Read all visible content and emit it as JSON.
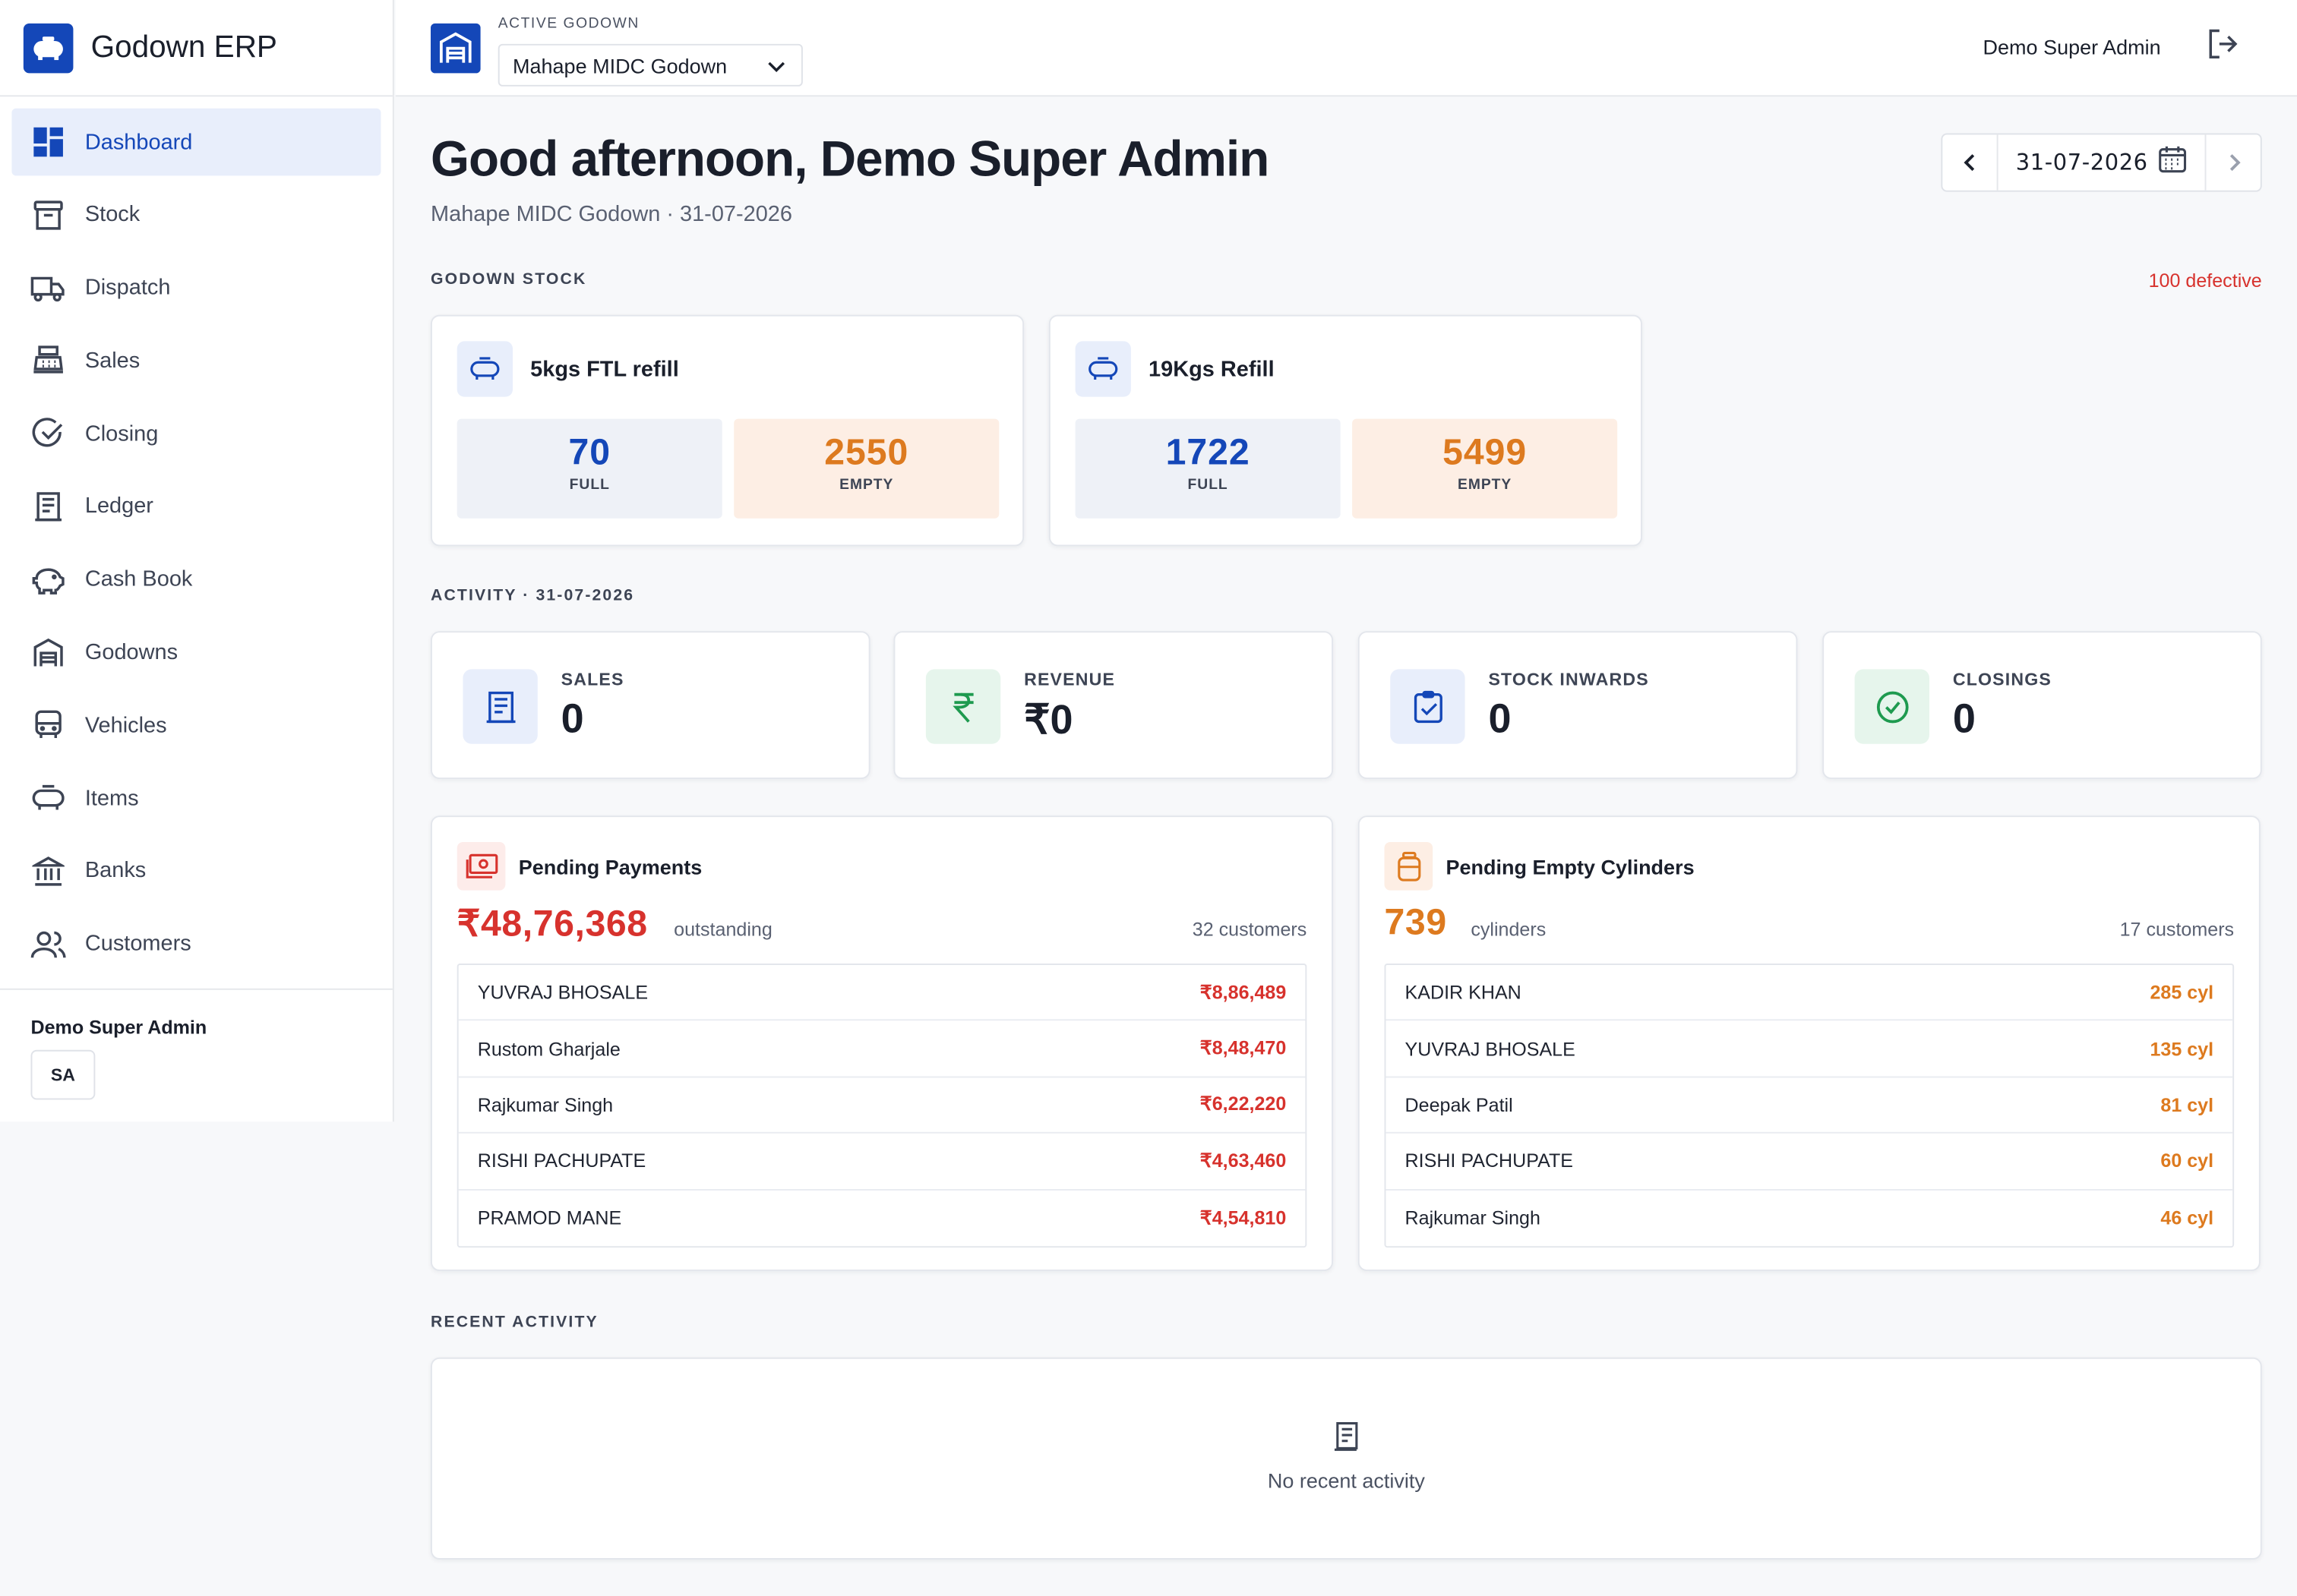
{
  "brand": {
    "name": "Godown ERP"
  },
  "sidebar": {
    "items": [
      {
        "label": "Dashboard",
        "icon": "dashboard-icon",
        "active": true
      },
      {
        "label": "Stock",
        "icon": "archive-icon"
      },
      {
        "label": "Dispatch",
        "icon": "truck-icon"
      },
      {
        "label": "Sales",
        "icon": "cash-register-icon"
      },
      {
        "label": "Closing",
        "icon": "check-circle-icon"
      },
      {
        "label": "Ledger",
        "icon": "receipt-icon"
      },
      {
        "label": "Cash Book",
        "icon": "piggy-bank-icon"
      },
      {
        "label": "Godowns",
        "icon": "warehouse-icon"
      },
      {
        "label": "Vehicles",
        "icon": "bus-icon"
      },
      {
        "label": "Items",
        "icon": "cylinder-icon"
      },
      {
        "label": "Banks",
        "icon": "bank-icon"
      },
      {
        "label": "Customers",
        "icon": "users-icon"
      }
    ],
    "user_name": "Demo Super Admin",
    "user_initials": "SA"
  },
  "header": {
    "active_label": "ACTIVE GODOWN",
    "godown": "Mahape MIDC Godown",
    "user": "Demo Super Admin"
  },
  "main": {
    "greeting": "Good afternoon, Demo Super Admin",
    "subline": "Mahape MIDC Godown · 31-07-2026",
    "date": "31-07-2026",
    "stock_title": "GODOWN STOCK",
    "defective": "100 defective",
    "stock": [
      {
        "name": "5kgs FTL refill",
        "full": "70",
        "full_label": "FULL",
        "empty": "2550",
        "empty_label": "EMPTY"
      },
      {
        "name": "19Kgs Refill",
        "full": "1722",
        "full_label": "FULL",
        "empty": "5499",
        "empty_label": "EMPTY"
      }
    ],
    "activity_title": "ACTIVITY · 31-07-2026",
    "activity": [
      {
        "label": "SALES",
        "value": "0"
      },
      {
        "label": "REVENUE",
        "value": "₹0"
      },
      {
        "label": "STOCK INWARDS",
        "value": "0"
      },
      {
        "label": "CLOSINGS",
        "value": "0"
      }
    ],
    "payments": {
      "title": "Pending Payments",
      "total": "₹48,76,368",
      "unit": "outstanding",
      "count": "32 customers",
      "rows": [
        {
          "name": "YUVRAJ BHOSALE",
          "value": "₹8,86,489"
        },
        {
          "name": "Rustom Gharjale",
          "value": "₹8,48,470"
        },
        {
          "name": "Rajkumar Singh",
          "value": "₹6,22,220"
        },
        {
          "name": "RISHI PACHUPATE",
          "value": "₹4,63,460"
        },
        {
          "name": "PRAMOD MANE",
          "value": "₹4,54,810"
        }
      ]
    },
    "cylinders": {
      "title": "Pending Empty Cylinders",
      "total": "739",
      "unit": "cylinders",
      "count": "17 customers",
      "rows": [
        {
          "name": "KADIR KHAN",
          "value": "285 cyl"
        },
        {
          "name": "YUVRAJ BHOSALE",
          "value": "135 cyl"
        },
        {
          "name": "Deepak Patil",
          "value": "81 cyl"
        },
        {
          "name": "RISHI PACHUPATE",
          "value": "60 cyl"
        },
        {
          "name": "Rajkumar Singh",
          "value": "46 cyl"
        }
      ]
    },
    "recent_title": "RECENT ACTIVITY",
    "recent_empty": "No recent activity"
  },
  "colors": {
    "accent": "#1447b8",
    "danger": "#d7322d",
    "warning": "#dd7a1f",
    "success": "#1e9a4f"
  }
}
